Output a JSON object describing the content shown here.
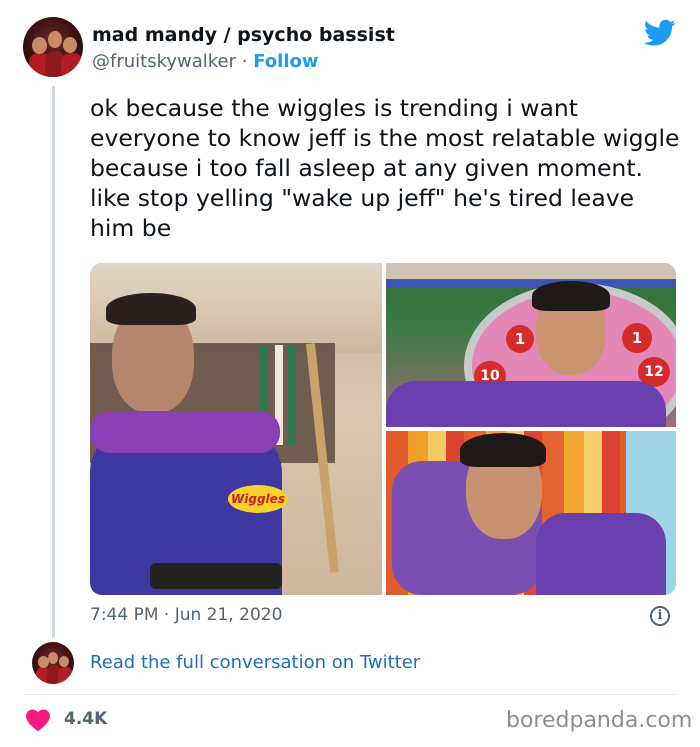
{
  "author": {
    "name": "mad mandy / psycho bassist",
    "handle": "@fruitskywalker",
    "separator": "·",
    "follow_label": "Follow"
  },
  "tweet": {
    "text": "ok because the wiggles is trending i want everyone to know jeff is the most relatable wiggle because i too fall asleep at any given moment. like stop yelling \"wake up jeff\" he's tired leave him be",
    "time": "7:44 PM",
    "date": "Jun 21, 2020",
    "separator": "·"
  },
  "media": {
    "images": [
      {
        "logo_text": "Wiggles"
      },
      {
        "numbers": [
          "1",
          "1",
          "10",
          "12"
        ]
      },
      {}
    ]
  },
  "footer": {
    "read_more": "Read the full conversation on Twitter",
    "likes": "4.4K",
    "credit": "boredpanda.com"
  },
  "colors": {
    "accent": "#1d9bf0",
    "link": "#1d6fb8",
    "heart": "#f91880",
    "muted": "#536471"
  },
  "icons": {
    "brand": "twitter-bird-icon",
    "info": "info-icon",
    "like": "heart-icon"
  }
}
